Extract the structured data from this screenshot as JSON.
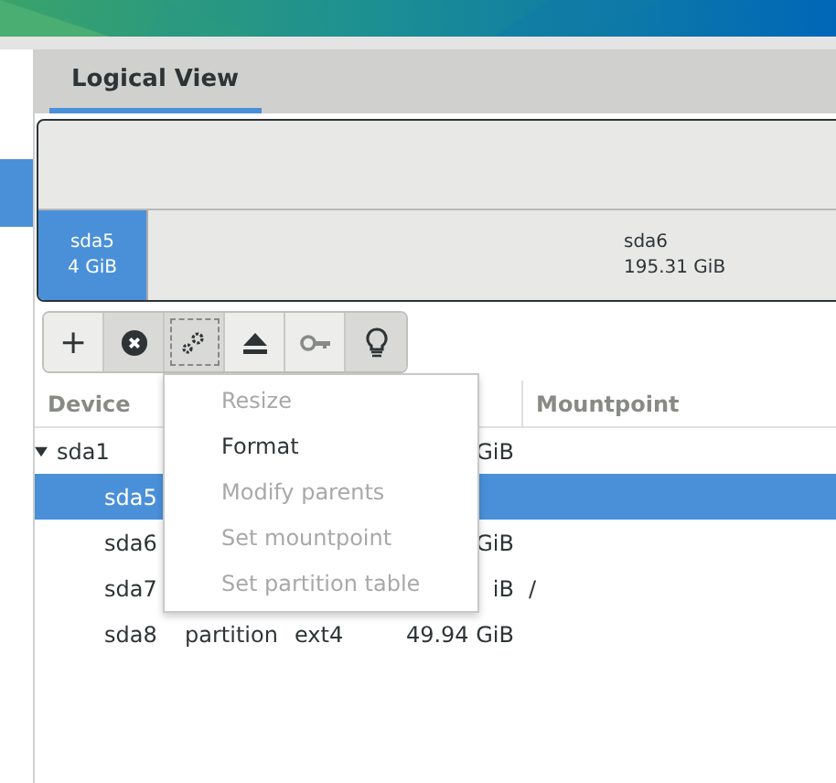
{
  "sidebar": {
    "items": [
      {
        "selected": true
      }
    ]
  },
  "tabs": [
    {
      "label": "Logical View",
      "selected": true
    }
  ],
  "partition_bar": [
    {
      "name": "sda5",
      "size": "4 GiB",
      "selected": true
    },
    {
      "name": "sda6",
      "size": "195.31 GiB",
      "selected": false
    }
  ],
  "toolbar": [
    {
      "kind": "add",
      "text": "+",
      "pressed": false,
      "focused": false
    },
    {
      "kind": "delete",
      "pressed": true,
      "focused": false
    },
    {
      "kind": "settings",
      "pressed": true,
      "focused": true
    },
    {
      "kind": "eject",
      "pressed": false,
      "focused": false
    },
    {
      "kind": "key",
      "pressed": false,
      "focused": false
    },
    {
      "kind": "bulb",
      "pressed": true,
      "focused": false
    }
  ],
  "table": {
    "columns": [
      "Device",
      "Mountpoint"
    ],
    "rows": [
      {
        "device": "sda1",
        "expanded": true,
        "size": "GiB",
        "selected": false,
        "children": [
          {
            "device": "sda5",
            "selected": true
          },
          {
            "device": "sda6",
            "size": "GiB",
            "selected": false
          },
          {
            "device": "sda7",
            "size": "iB",
            "mountpoint": "/",
            "selected": false
          },
          {
            "device": "sda8",
            "type": "partition",
            "format": "ext4",
            "size": "49.94 GiB",
            "selected": false
          }
        ]
      }
    ]
  },
  "menu": [
    {
      "label": "Resize",
      "disabled": true
    },
    {
      "label": "Format",
      "disabled": false
    },
    {
      "label": "Modify parents",
      "disabled": true
    },
    {
      "label": "Set mountpoint",
      "disabled": true
    },
    {
      "label": "Set partition table",
      "disabled": true
    }
  ]
}
